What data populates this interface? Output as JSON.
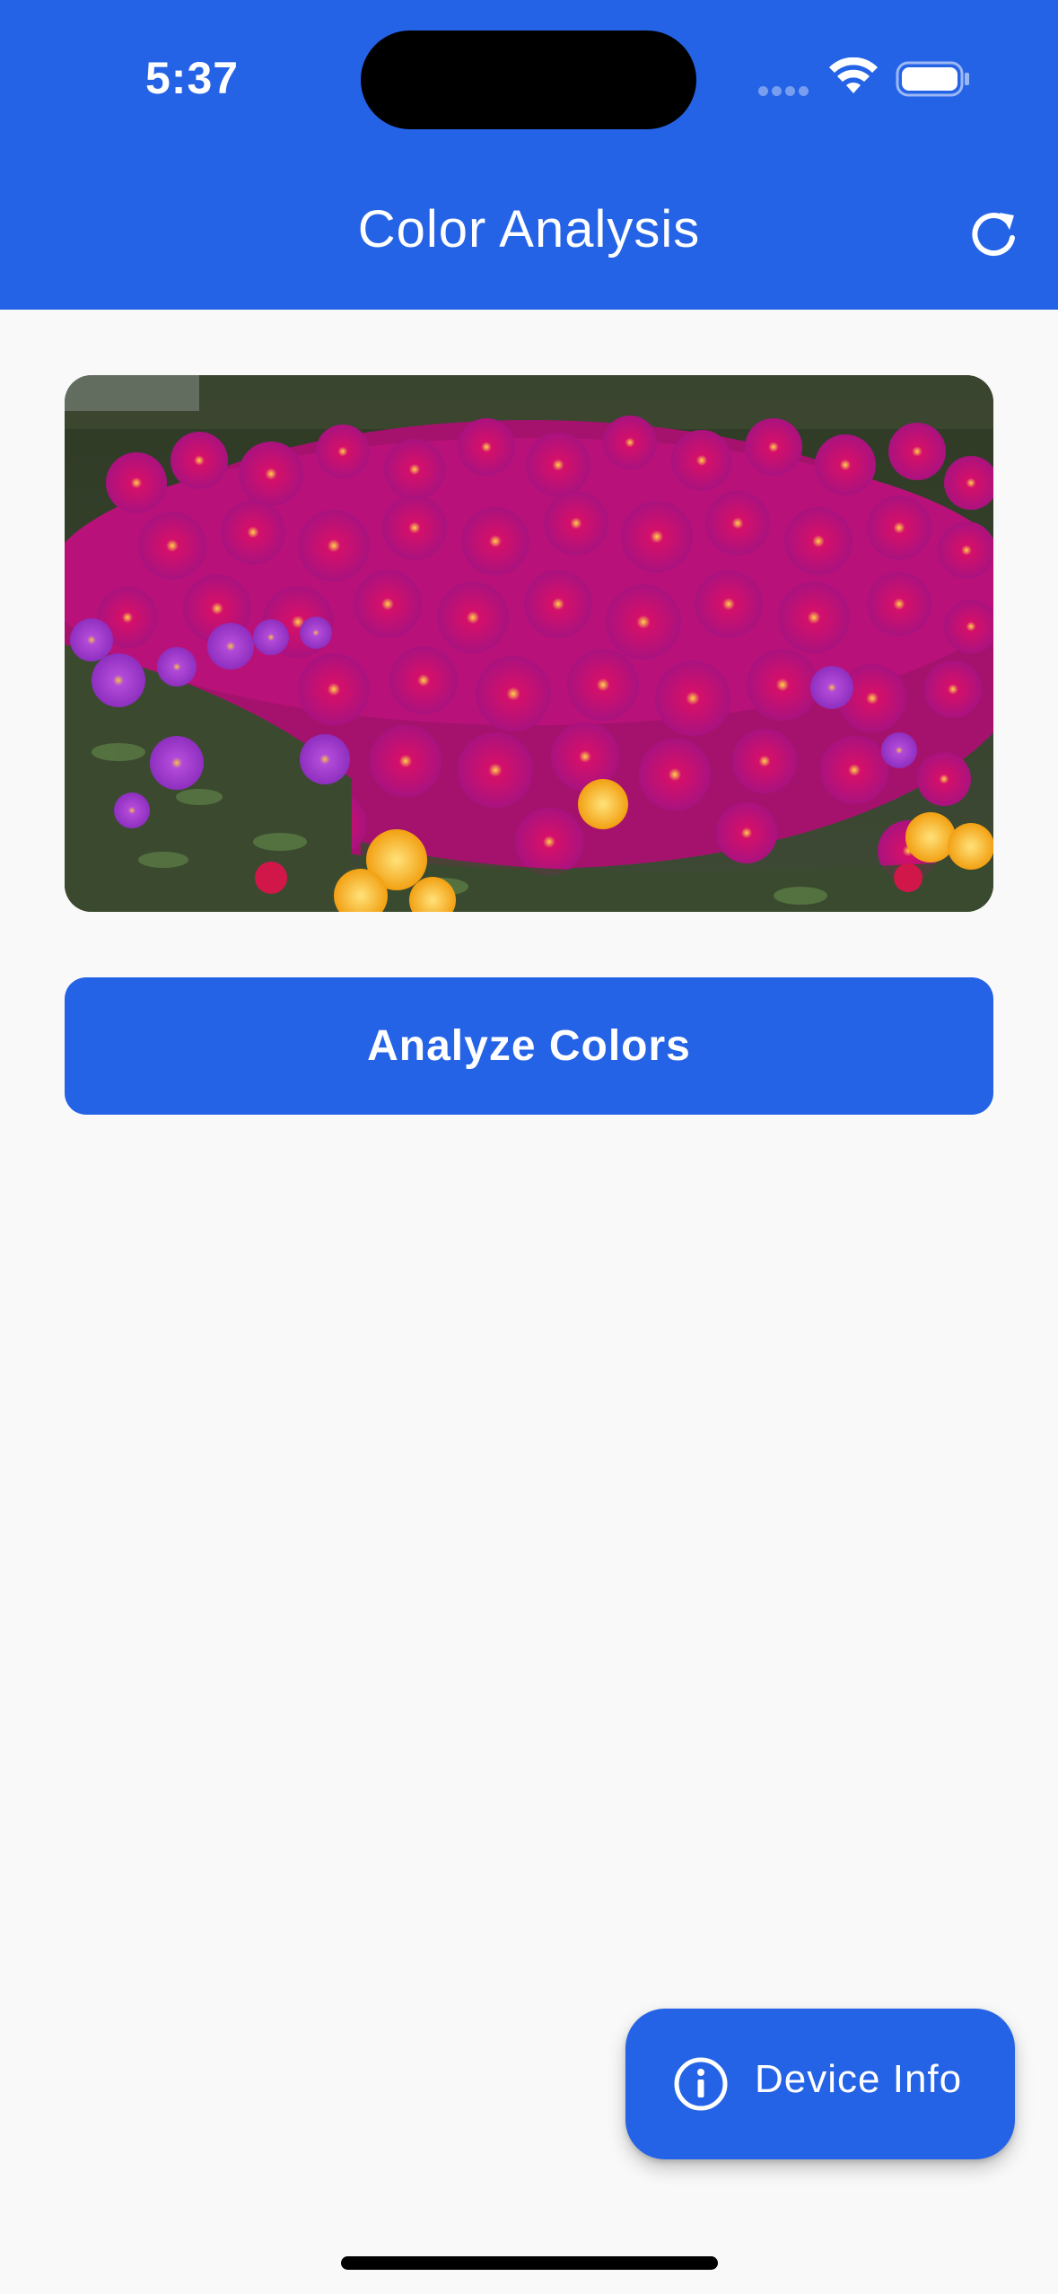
{
  "status_bar": {
    "time": "5:37"
  },
  "app_bar": {
    "title": "Color Analysis",
    "refresh_icon": "refresh-icon",
    "background_color": "#2563e6"
  },
  "image": {
    "subject": "flower-field-photo"
  },
  "analyze_button": {
    "label": "Analyze Colors"
  },
  "fab": {
    "label": "Device Info",
    "icon": "info-icon"
  },
  "colors": {
    "accent": "#2563e6",
    "background": "#f9f9f9"
  }
}
